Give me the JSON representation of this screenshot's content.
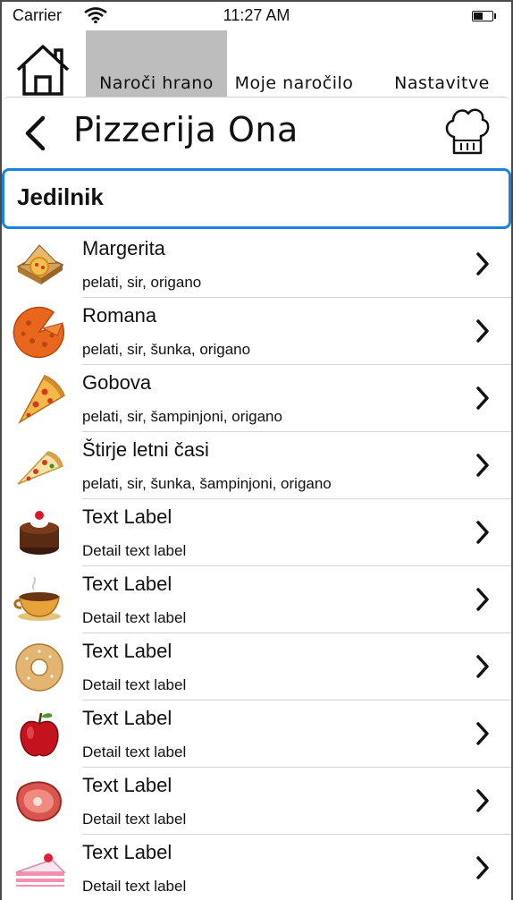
{
  "status_bar": {
    "carrier": "Carrier",
    "time": "11:27 AM"
  },
  "tabs": [
    {
      "label": "Naroči hrano",
      "active": true
    },
    {
      "label": "Moje naročilo",
      "active": false
    },
    {
      "label": "Nastavitve",
      "active": false
    }
  ],
  "header": {
    "title": "Pizzerija Ona"
  },
  "section": {
    "title": "Jedilnik"
  },
  "colors": {
    "accent": "#1a82e2",
    "active_tab": "#bdbdbd"
  },
  "menu_items": [
    {
      "title": "Margerita",
      "detail": "pelati, sir, origano",
      "icon": "pizza-box-icon"
    },
    {
      "title": "Romana",
      "detail": "pelati, sir, šunka, origano",
      "icon": "pizza-pie-icon"
    },
    {
      "title": "Gobova",
      "detail": "pelati, sir, šampinjoni, origano",
      "icon": "pizza-slice-icon"
    },
    {
      "title": "Štirje letni časi",
      "detail": "pelati, sir, šunka, šampinjoni, origano",
      "icon": "pizza-slice-small-icon"
    },
    {
      "title": "Text Label",
      "detail": "Detail text label",
      "icon": "cake-icon"
    },
    {
      "title": "Text Label",
      "detail": "Detail text label",
      "icon": "coffee-cup-icon"
    },
    {
      "title": "Text Label",
      "detail": "Detail text label",
      "icon": "donut-icon"
    },
    {
      "title": "Text Label",
      "detail": "Detail text label",
      "icon": "apple-icon"
    },
    {
      "title": "Text Label",
      "detail": "Detail text label",
      "icon": "steak-icon"
    },
    {
      "title": "Text Label",
      "detail": "Detail text label",
      "icon": "cake-slice-icon"
    }
  ]
}
